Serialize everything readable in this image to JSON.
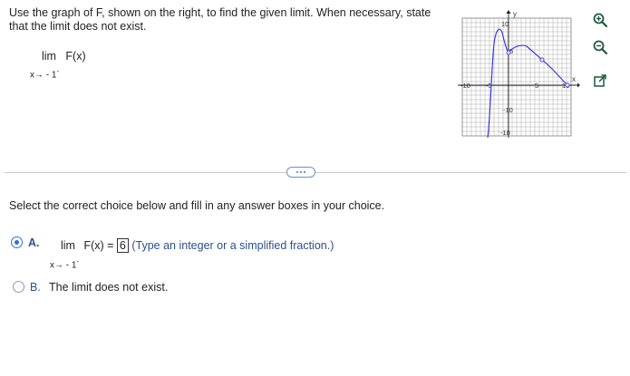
{
  "question": {
    "prompt": "Use the graph of F, shown on the right, to find the given limit. When necessary, state that the limit does not exist.",
    "limit_word": "lim",
    "function_text": "F(x)",
    "subscript": "x→ - 1",
    "subscript_sign": "-"
  },
  "graph": {
    "x_axis_label": "x",
    "y_axis_label": "y",
    "tick_labels": [
      "10",
      "-5",
      "-10",
      "5",
      "10",
      "-10",
      "5",
      "5"
    ]
  },
  "tools": {
    "icons": [
      "zoom-in-icon",
      "zoom-out-icon",
      "popout-icon"
    ]
  },
  "divider": {
    "more_label": "..."
  },
  "instructions": "Select the correct choice below and fill in any answer boxes in your choice.",
  "options": {
    "a": {
      "letter": "A.",
      "lim": "lim",
      "func_eq": "F(x) =",
      "answer_value": "6",
      "hint": "(Type an integer or a simplified fraction.)",
      "subscript": "x→ - 1",
      "subscript_sign": "-",
      "selected": true
    },
    "b": {
      "letter": "B.",
      "text": "The limit does not exist.",
      "selected": false
    }
  },
  "colors": {
    "accent": "#2f6fd6",
    "curve": "#3a3ae0",
    "grid": "#999999"
  }
}
